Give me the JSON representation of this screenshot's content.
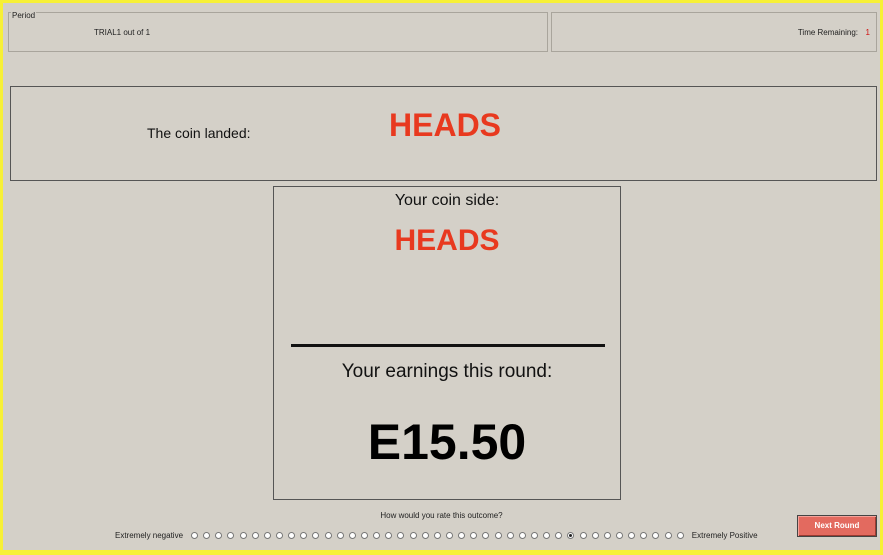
{
  "header": {
    "group_title": "Period",
    "trial_label": "TRIAL1  out of  1",
    "time_label": "Time Remaining:",
    "time_value": "1"
  },
  "coin": {
    "label": "The coin landed:",
    "result": "HEADS"
  },
  "summary": {
    "side_label": "Your coin side:",
    "side_value": "HEADS",
    "earnings_label": "Your earnings this round:",
    "earnings_value": "E15.50"
  },
  "rating": {
    "question": "How would you rate this outcome?",
    "left_label": "Extremely negative",
    "right_label": "Extremely Positive",
    "option_count": 41,
    "selected_index": 31
  },
  "controls": {
    "next_label": "Next Round"
  },
  "colors": {
    "background": "#f7f036",
    "panel": "#d4d0c8",
    "accent_red": "#e8391f",
    "button": "#e36a5f"
  }
}
